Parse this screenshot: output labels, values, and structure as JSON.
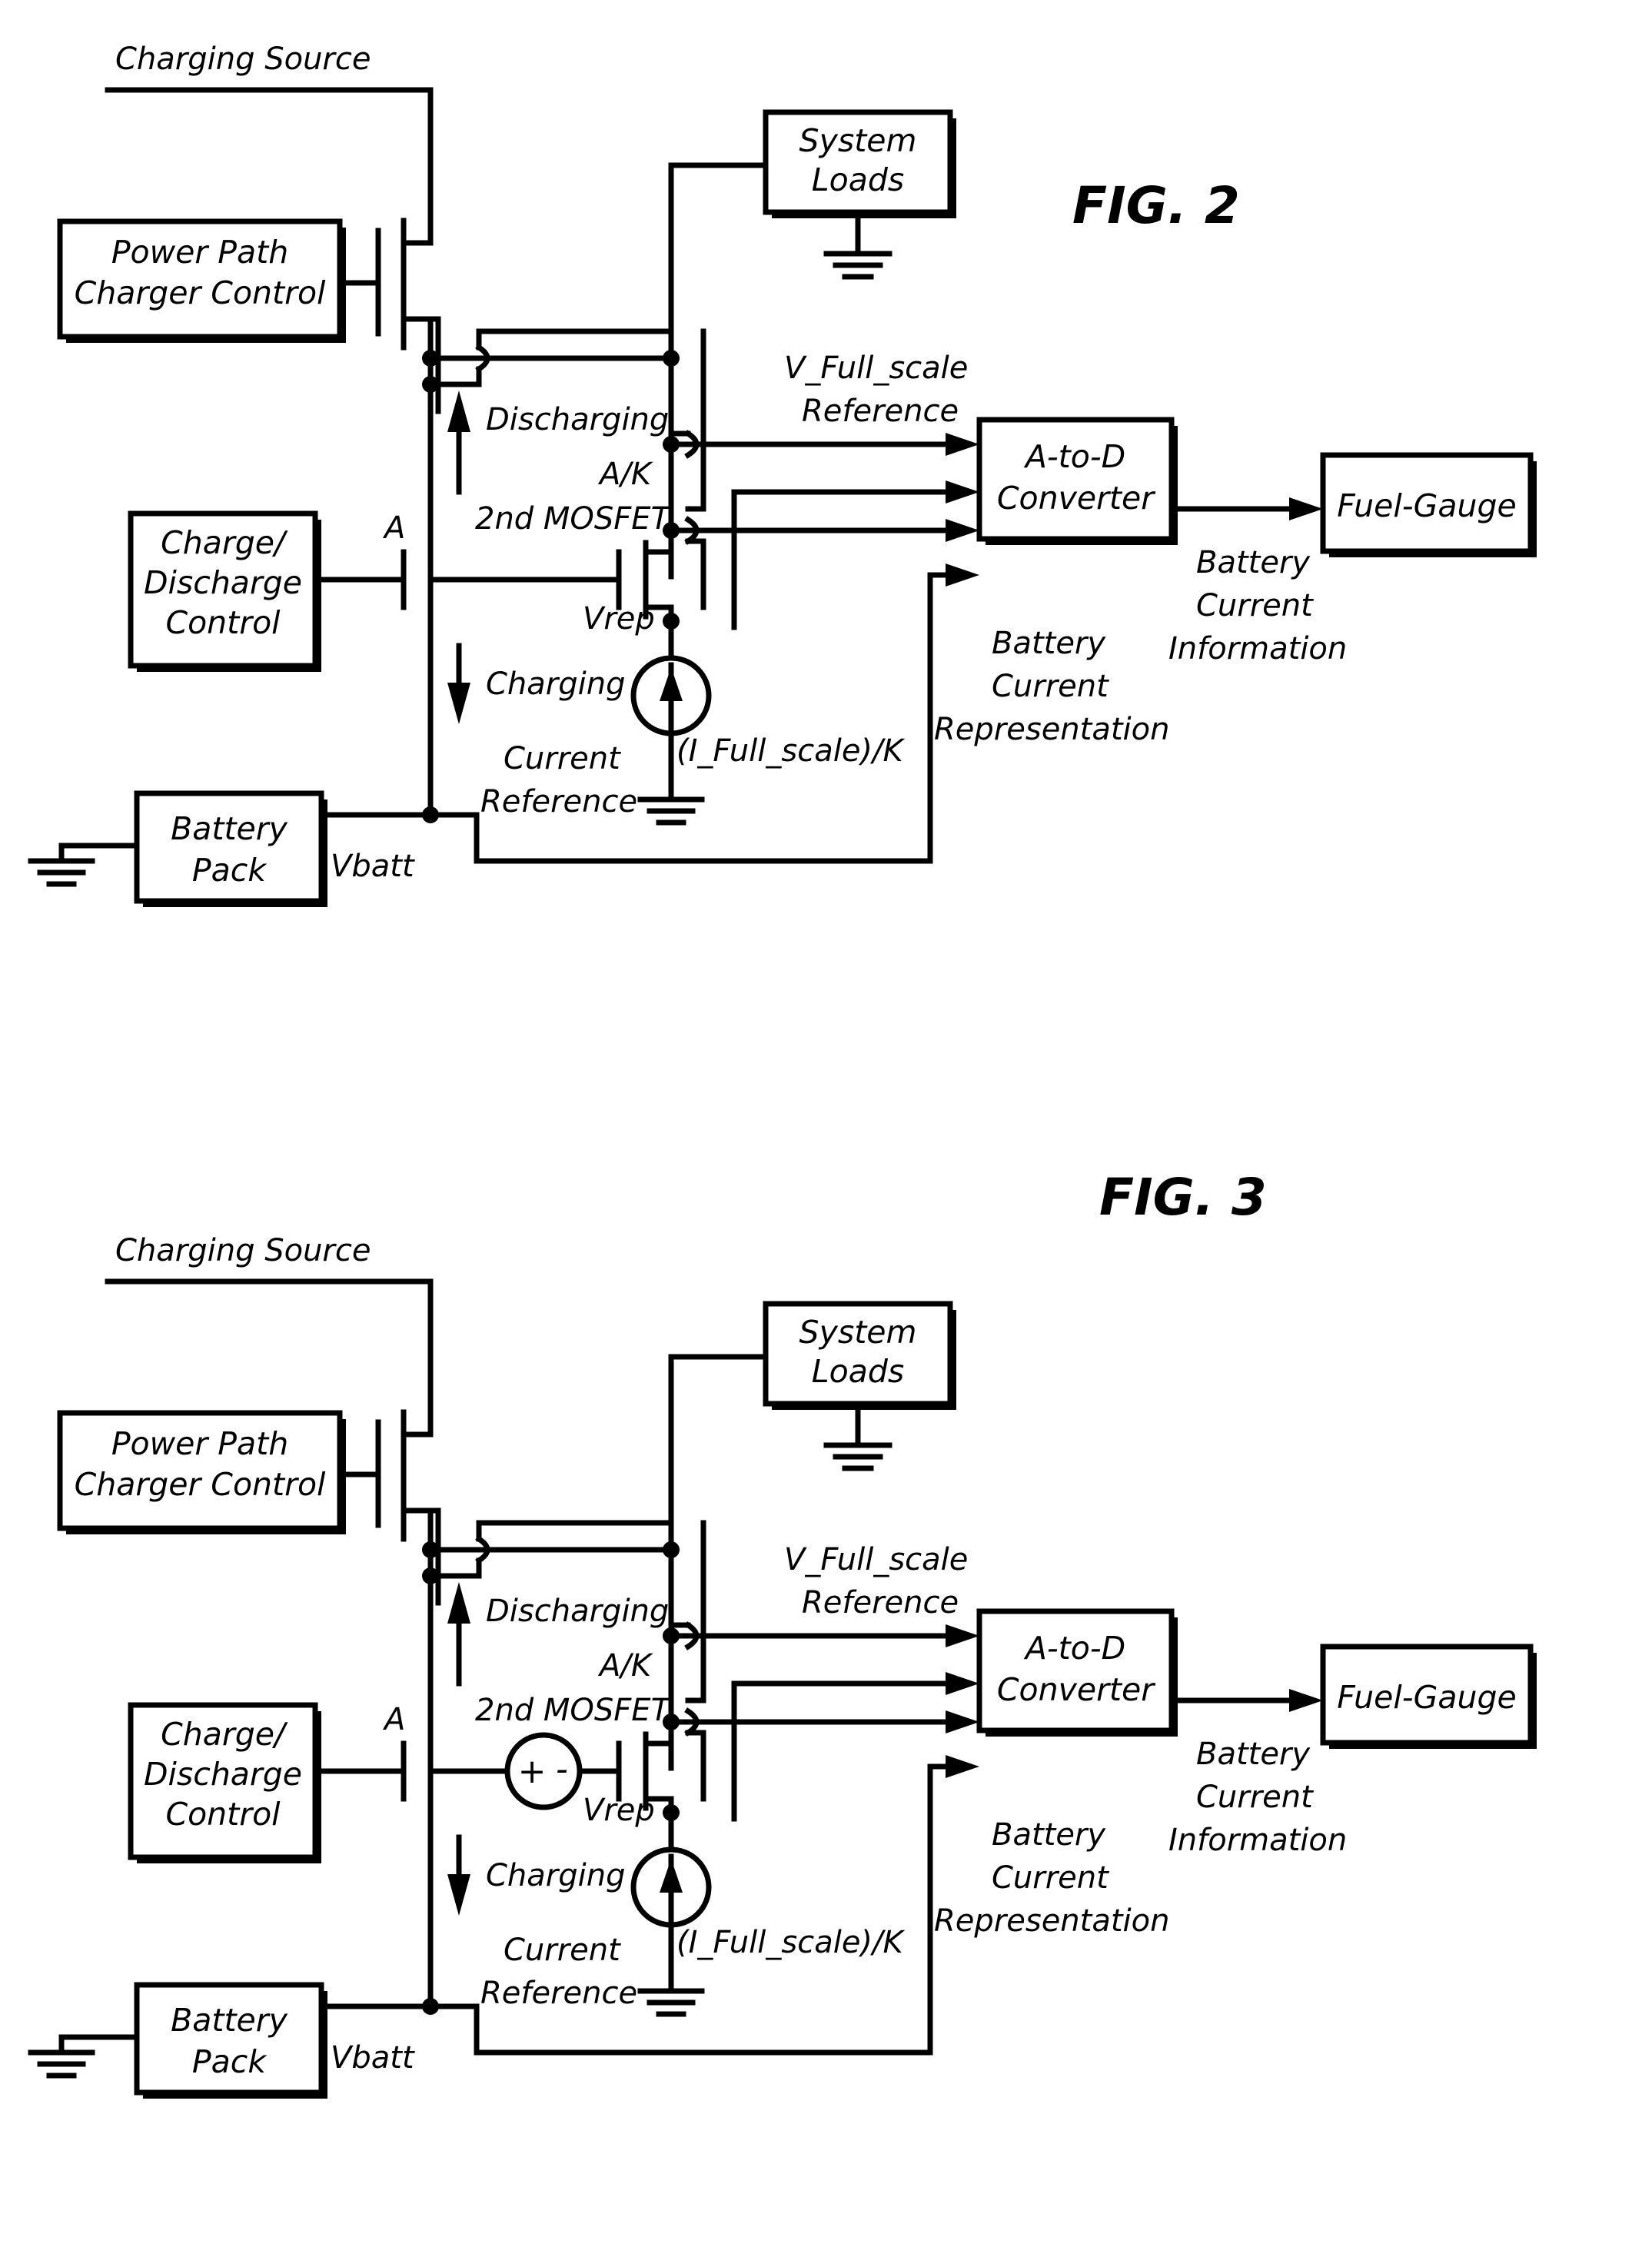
{
  "figures": [
    {
      "id": "fig2",
      "caption": "FIG. 2",
      "has_voltage_source": false,
      "labels": {
        "charging_source": "Charging Source",
        "power_path_line1": "Power Path",
        "power_path_line2": "Charger Control",
        "charge_discharge_line1": "Charge/",
        "charge_discharge_line2": "Discharge",
        "charge_discharge_line3": "Control",
        "battery_pack_line1": "Battery",
        "battery_pack_line2": "Pack",
        "system_loads_line1": "System",
        "system_loads_line2": "Loads",
        "adc_line1": "A-to-D",
        "adc_line2": "Converter",
        "fuel_gauge": "Fuel-Gauge",
        "node_a": "A",
        "vbatt": "Vbatt",
        "vrep": "Vrep",
        "discharging": "Discharging",
        "charging": "Charging",
        "ak": "A/K",
        "second_mosfet": "2nd MOSFET",
        "v_full_scale_line1": "V_Full_scale",
        "v_full_scale_line2": "Reference",
        "current_ref_line1": "Current",
        "current_ref_line2": "Reference",
        "i_full_scale_k": "(I_Full_scale)/K",
        "battery_current_rep_line1": "Battery",
        "battery_current_rep_line2": "Current",
        "battery_current_rep_line3": "Representation",
        "battery_current_info_line1": "Battery",
        "battery_current_info_line2": "Current",
        "battery_current_info_line3": "Information",
        "vsource_plus": "+",
        "vsource_minus": "-"
      }
    },
    {
      "id": "fig3",
      "caption": "FIG. 3",
      "has_voltage_source": true,
      "labels": {
        "charging_source": "Charging Source",
        "power_path_line1": "Power Path",
        "power_path_line2": "Charger Control",
        "charge_discharge_line1": "Charge/",
        "charge_discharge_line2": "Discharge",
        "charge_discharge_line3": "Control",
        "battery_pack_line1": "Battery",
        "battery_pack_line2": "Pack",
        "system_loads_line1": "System",
        "system_loads_line2": "Loads",
        "adc_line1": "A-to-D",
        "adc_line2": "Converter",
        "fuel_gauge": "Fuel-Gauge",
        "node_a": "A",
        "vbatt": "Vbatt",
        "vrep": "Vrep",
        "discharging": "Discharging",
        "charging": "Charging",
        "ak": "A/K",
        "second_mosfet": "2nd MOSFET",
        "v_full_scale_line1": "V_Full_scale",
        "v_full_scale_line2": "Reference",
        "current_ref_line1": "Current",
        "current_ref_line2": "Reference",
        "i_full_scale_k": "(I_Full_scale)/K",
        "battery_current_rep_line1": "Battery",
        "battery_current_rep_line2": "Current",
        "battery_current_rep_line3": "Representation",
        "battery_current_info_line1": "Battery",
        "battery_current_info_line2": "Current",
        "battery_current_info_line3": "Information",
        "vsource_plus": "+",
        "vsource_minus": "-"
      }
    }
  ],
  "colors": {
    "ink": "#000000",
    "paper": "#ffffff"
  }
}
